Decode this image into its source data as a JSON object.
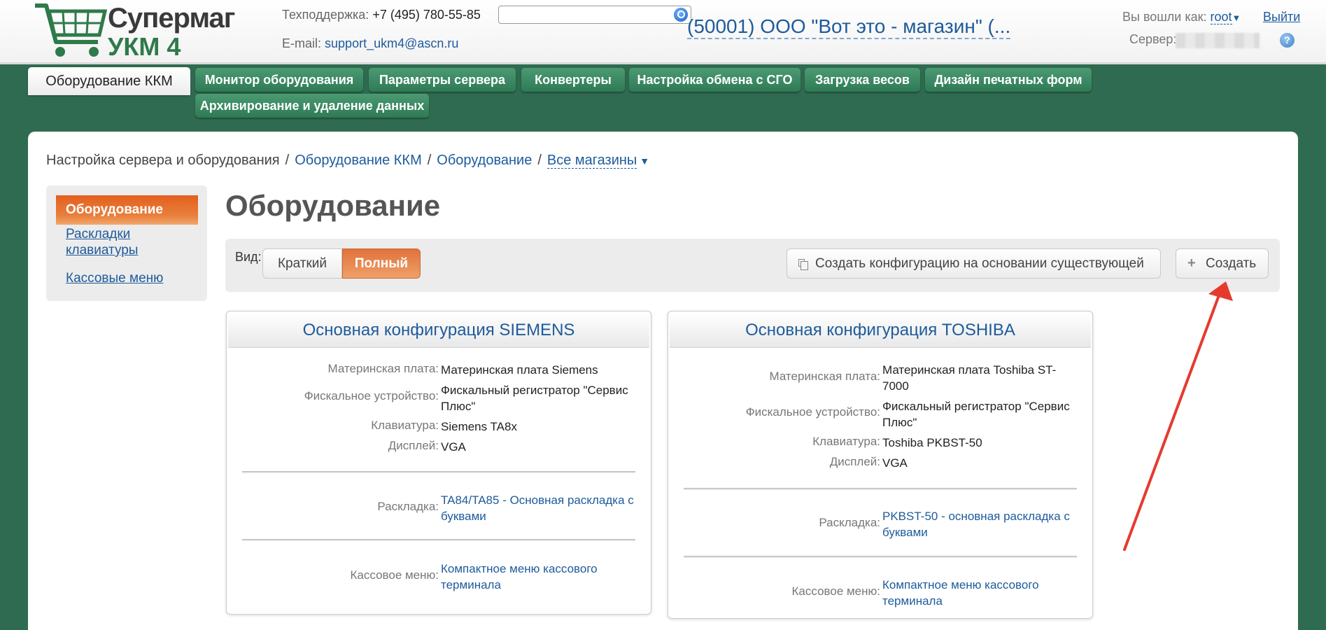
{
  "header": {
    "logo_line1": "Супермаг",
    "logo_line2": "УКМ 4",
    "support_label": "Техподдержка:",
    "support_phone": "+7 (495) 780-55-85",
    "email_label": "E-mail:",
    "email_value": "support_ukm4@ascn.ru",
    "search_value": "",
    "store_name": "(50001) ООО \"Вот это - магазин\" (...",
    "login_label": "Вы вошли как:",
    "user": "root",
    "logout": "Выйти",
    "server_label": "Сервер:",
    "help": "?"
  },
  "tabs": {
    "active": "Оборудование ККМ",
    "items": [
      "Монитор оборудования",
      "Параметры сервера",
      "Конвертеры",
      "Настройка обмена с СГО",
      "Загрузка весов",
      "Дизайн печатных форм",
      "Архивирование и удаление данных"
    ]
  },
  "breadcrumb": {
    "root": "Настройка сервера и оборудования",
    "item1": "Оборудование ККМ",
    "item2": "Оборудование",
    "item3": "Все магазины",
    "sep": "/"
  },
  "sidebar": {
    "active": "Оборудование",
    "link1": "Раскладки клавиатуры",
    "link2": "Кассовые меню"
  },
  "page_title": "Оборудование",
  "toolbar": {
    "view_label": "Вид:",
    "short": "Краткий",
    "full": "Полный",
    "copy": "Создать конфигурацию на основании существующей",
    "create": "Создать"
  },
  "cards": [
    {
      "title": "Основная конфигурация SIEMENS",
      "motherboard_label": "Материнская плата:",
      "motherboard": "Материнская плата Siemens",
      "fiscal_label": "Фискальное устройство:",
      "fiscal": "Фискальный регистратор \"Сервис Плюс\"",
      "keyboard_label": "Клавиатура:",
      "keyboard": "Siemens TA8x",
      "display_label": "Дисплей:",
      "display": "VGA",
      "layout_label": "Раскладка:",
      "layout": "TA84/TA85 - Основная раскладка с буквами",
      "menu_label": "Кассовое меню:",
      "menu": "Компактное меню кассового терминала"
    },
    {
      "title": "Основная конфигурация TOSHIBA",
      "motherboard_label": "Материнская плата:",
      "motherboard": "Материнская плата Toshiba ST-7000",
      "fiscal_label": "Фискальное устройство:",
      "fiscal": "Фискальный регистратор \"Сервис Плюс\"",
      "keyboard_label": "Клавиатура:",
      "keyboard": "Toshiba PKBST-50",
      "display_label": "Дисплей:",
      "display": "VGA",
      "layout_label": "Раскладка:",
      "layout": "PKBST-50 - основная раскладка с буквами",
      "menu_label": "Кассовое меню:",
      "menu": "Компактное меню кассового терминала"
    }
  ],
  "colors": {
    "background": "#2f6b50",
    "tab": "#3b8a63",
    "accent": "#e4672a",
    "link": "#1e5b9b",
    "annotation_arrow": "#e53b2f"
  }
}
